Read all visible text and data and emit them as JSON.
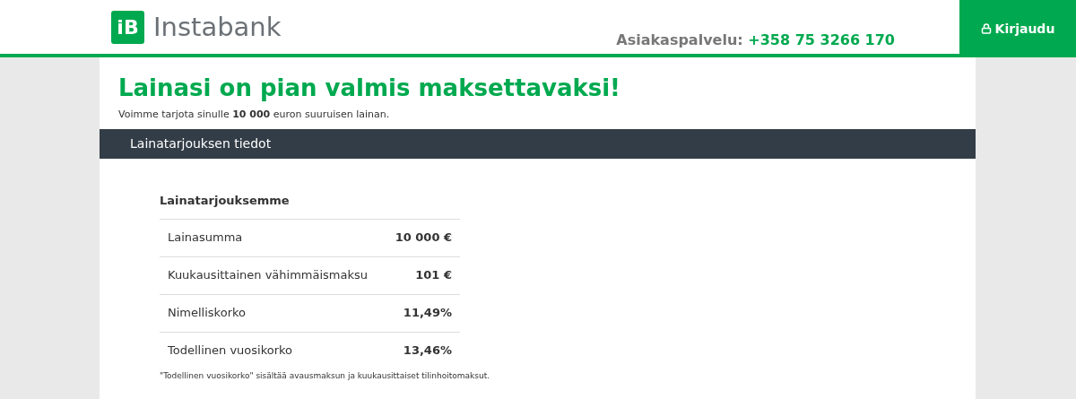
{
  "header": {
    "logo_mark": "iB",
    "logo_text": "Instabank",
    "service_label": "Asiakaspalvelu:",
    "service_phone": "+358 75 3266 170",
    "login_button": "Kirjaudu"
  },
  "title": "Lainasi on pian valmis maksettavaksi!",
  "subtitle": "Voimme tarjota sinulle **10 000** euron suuruisen lainan.",
  "section_bar": "Lainatarjouksen tiedot",
  "offer": {
    "heading": "Lainatarjouksemme",
    "rows": [
      {
        "label": "Lainasumma",
        "value": "10 000 €"
      },
      {
        "label": "Kuukausittainen vähimmäismaksu",
        "value": "101 €"
      },
      {
        "label": "Nimelliskorko",
        "value": "11,49%"
      },
      {
        "label": "Todellinen vuosikorko",
        "value": "13,46%"
      }
    ],
    "footnote": "\"Todellinen vuosikorko\" sisältää avausmaksun ja kuukausittaiset tilinhoitomaksut."
  }
}
